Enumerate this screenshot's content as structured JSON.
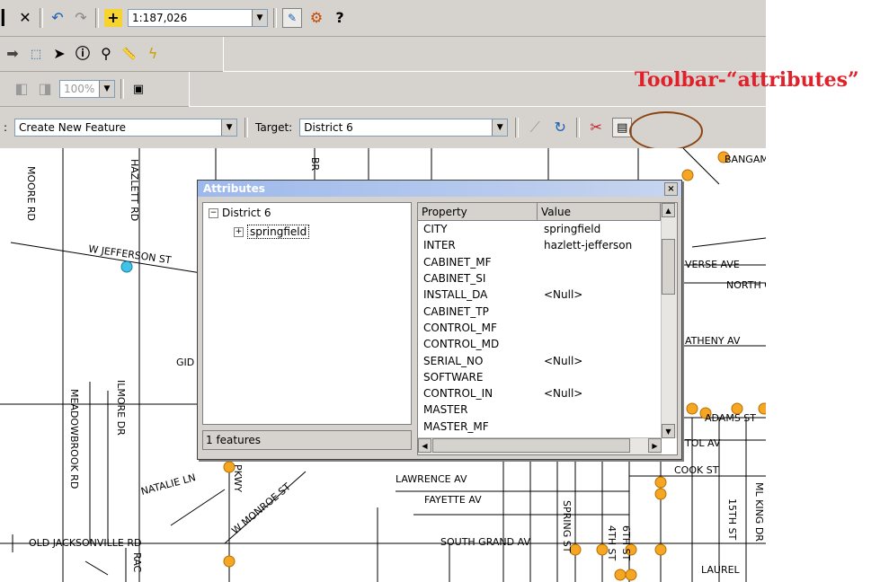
{
  "toolbar1": {
    "scale_value": "1:187,026",
    "icons": [
      "partial-icon",
      "delete-icon",
      "undo-icon",
      "redo-icon",
      "add-data-icon",
      "editor-toolbar-icon",
      "arctoolbox-icon",
      "whats-this-icon"
    ]
  },
  "toolbar2": {
    "icons": [
      "forward-extent-icon",
      "select-features-icon",
      "select-elements-icon",
      "identify-icon",
      "find-icon",
      "measure-icon",
      "hyperlink-icon"
    ]
  },
  "toolbar3": {
    "zoom_value": "100%",
    "icons": [
      "zoom-in-fixed-icon",
      "zoom-out-fixed-icon",
      "layout-icon"
    ]
  },
  "editor": {
    "task_value": "Create New Feature",
    "target_label": "Target:",
    "target_value": "District 6",
    "icons": [
      "sketch-tool-icon",
      "rotate-tool-icon",
      "split-icon",
      "attributes-icon"
    ]
  },
  "annotation": {
    "text": "Toolbar-“attributes”",
    "color": "#e0202a"
  },
  "attributes_window": {
    "title": "Attributes",
    "close": "×",
    "tree_root": "District 6",
    "tree_child": "springfield",
    "tree_expander": "−",
    "tree_child_expander": "+",
    "status": "1 features",
    "columns": [
      "Property",
      "Value"
    ],
    "rows": [
      {
        "property": "CITY",
        "value": "springfield"
      },
      {
        "property": "INTER",
        "value": "hazlett-jefferson"
      },
      {
        "property": "CABINET_MF",
        "value": ""
      },
      {
        "property": "CABINET_SI",
        "value": ""
      },
      {
        "property": "INSTALL_DA",
        "value": "<Null>"
      },
      {
        "property": "CABINET_TP",
        "value": ""
      },
      {
        "property": "CONTROL_MF",
        "value": ""
      },
      {
        "property": "CONTROL_MD",
        "value": ""
      },
      {
        "property": "SERIAL_NO",
        "value": "<Null>"
      },
      {
        "property": "SOFTWARE",
        "value": ""
      },
      {
        "property": "CONTROL_IN",
        "value": "<Null>"
      },
      {
        "property": "MASTER",
        "value": ""
      },
      {
        "property": "MASTER_MF",
        "value": ""
      }
    ]
  },
  "map_labels": [
    {
      "text": "MOORE RD"
    },
    {
      "text": "HAZLETT RD"
    },
    {
      "text": "W JEFFERSON ST"
    },
    {
      "text": "GID"
    },
    {
      "text": "ILMORE DR"
    },
    {
      "text": "MEADOWBROOK RD"
    },
    {
      "text": "NATALIE LN"
    },
    {
      "text": "W MONROE ST"
    },
    {
      "text": "OLD JACKSONVILLE RD"
    },
    {
      "text": "LAWRENCE AV"
    },
    {
      "text": "FAYETTE AV"
    },
    {
      "text": "SOUTH GRAND AV"
    },
    {
      "text": "VERSE AVE"
    },
    {
      "text": "NORTH G"
    },
    {
      "text": "ATHENY AV"
    },
    {
      "text": "ADAMS ST"
    },
    {
      "text": "TOL AV"
    },
    {
      "text": "COOK ST"
    },
    {
      "text": "15TH ST"
    },
    {
      "text": "ML KING DR"
    },
    {
      "text": "LAUREL"
    },
    {
      "text": "BANGAM"
    },
    {
      "text": "SPRING ST"
    },
    {
      "text": "4TH ST"
    },
    {
      "text": "6TH ST"
    },
    {
      "text": "PKWY"
    },
    {
      "text": "BR"
    },
    {
      "text": "RAC"
    }
  ]
}
